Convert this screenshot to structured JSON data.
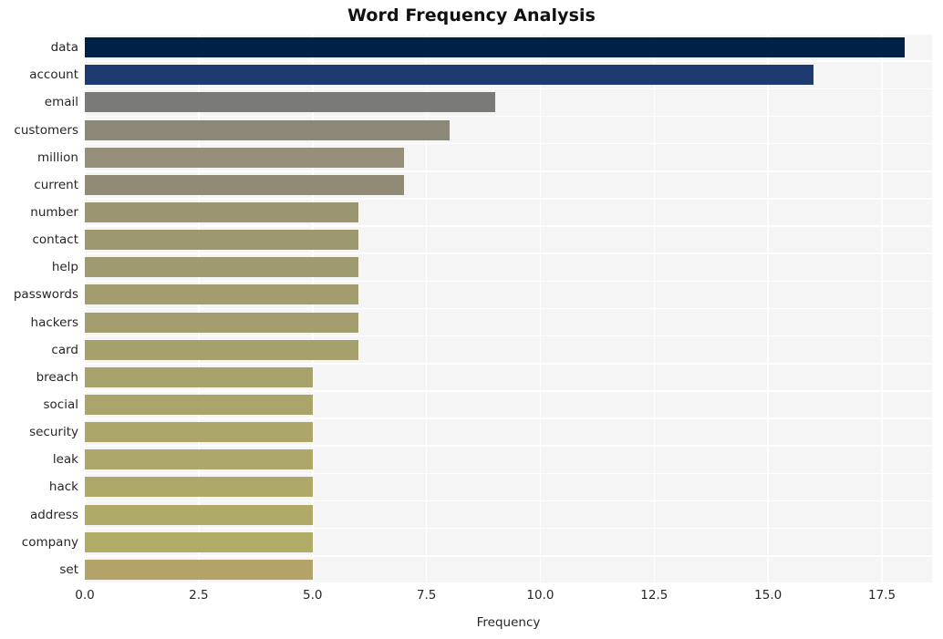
{
  "chart_data": {
    "type": "bar",
    "orientation": "horizontal",
    "title": "Word Frequency Analysis",
    "xlabel": "Frequency",
    "ylabel": "",
    "categories": [
      "data",
      "account",
      "email",
      "customers",
      "million",
      "current",
      "number",
      "contact",
      "help",
      "passwords",
      "hackers",
      "card",
      "breach",
      "social",
      "security",
      "leak",
      "hack",
      "address",
      "company",
      "set"
    ],
    "values": [
      18,
      16,
      9,
      8,
      7,
      7,
      6,
      6,
      6,
      6,
      6,
      6,
      5,
      5,
      5,
      5,
      5,
      5,
      5,
      5
    ],
    "xlim": [
      0.0,
      18.6
    ],
    "xticks": [
      0.0,
      2.5,
      5.0,
      7.5,
      10.0,
      12.5,
      15.0,
      17.5
    ],
    "xticklabels": [
      "0.0",
      "2.5",
      "5.0",
      "7.5",
      "10.0",
      "12.5",
      "15.0",
      "17.5"
    ],
    "grid": true,
    "legend": false,
    "bar_colors": [
      "#002147",
      "#1d3b70",
      "#7a7a78",
      "#8b8878",
      "#96907a",
      "#918b76",
      "#9b9572",
      "#9e9871",
      "#a09a70",
      "#a29c6f",
      "#a49e6e",
      "#a6a06d",
      "#a8a26c",
      "#aaa46b",
      "#aca66a",
      "#ada769",
      "#aea869",
      "#b0aa68",
      "#b1ab68",
      "#b3a369"
    ],
    "plot_background": "#f5f5f5",
    "grid_color": "#ffffff",
    "figure_background": "#ffffff"
  }
}
